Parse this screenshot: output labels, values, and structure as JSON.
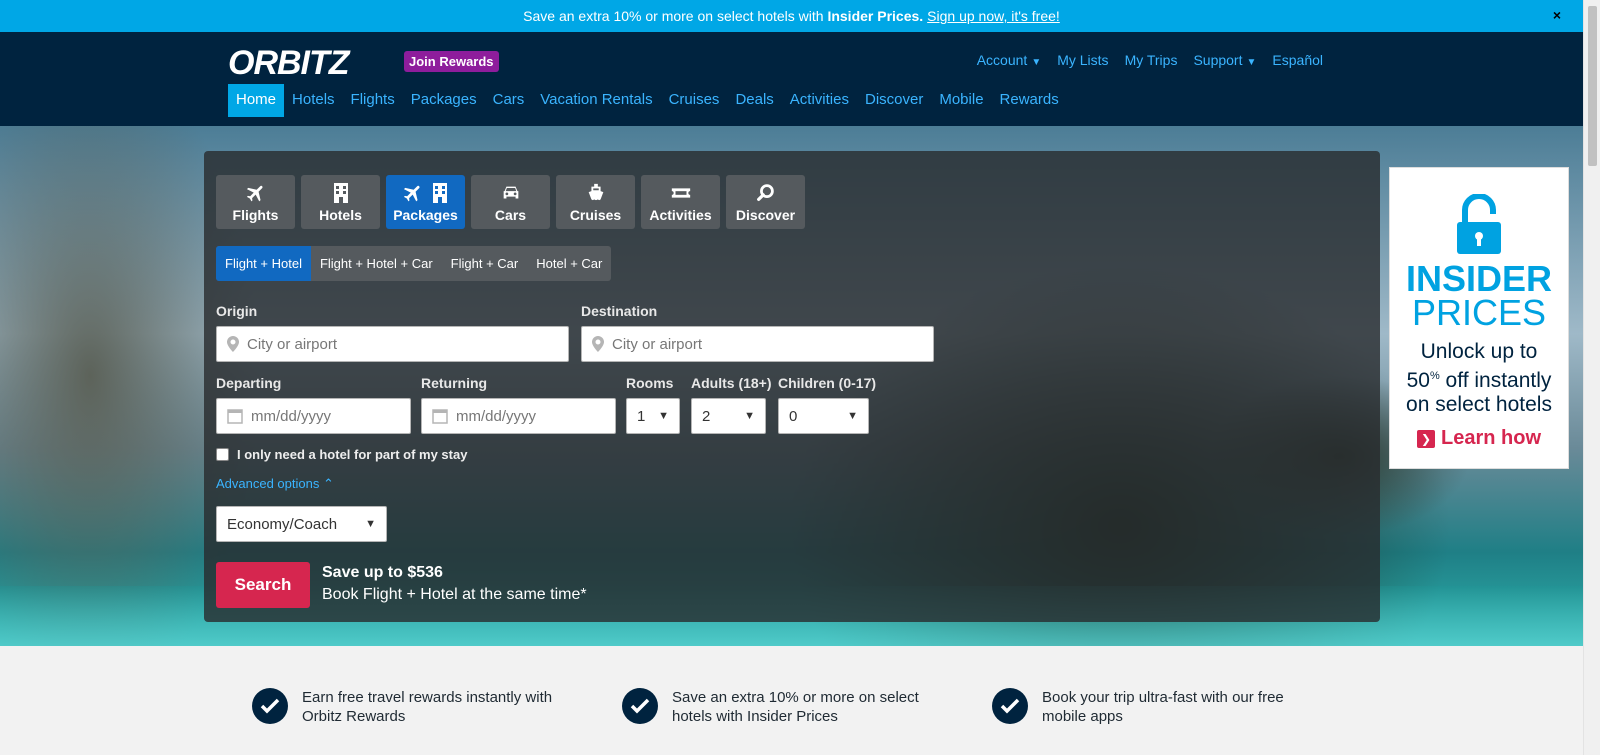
{
  "promo": {
    "text": "Save an extra 10% or more on select hotels with",
    "bold": "Insider Prices.",
    "link": "Sign up now, it's free!",
    "close": "×"
  },
  "header": {
    "logo_text": "ORBITZ",
    "join_rewards": "Join Rewards",
    "util_nav": [
      "Account",
      "My Lists",
      "My Trips",
      "Support",
      "Español"
    ],
    "main_nav": [
      "Home",
      "Hotels",
      "Flights",
      "Packages",
      "Cars",
      "Vacation Rentals",
      "Cruises",
      "Deals",
      "Activities",
      "Discover",
      "Mobile",
      "Rewards"
    ]
  },
  "search": {
    "tabs": [
      {
        "label": "Flights",
        "icon": "plane-icon"
      },
      {
        "label": "Hotels",
        "icon": "building-icon"
      },
      {
        "label": "Packages",
        "icon": "plane-building-icon"
      },
      {
        "label": "Cars",
        "icon": "car-icon"
      },
      {
        "label": "Cruises",
        "icon": "ship-icon"
      },
      {
        "label": "Activities",
        "icon": "ticket-icon"
      },
      {
        "label": "Discover",
        "icon": "magnifier-icon"
      }
    ],
    "subtabs": [
      "Flight + Hotel",
      "Flight + Hotel + Car",
      "Flight + Car",
      "Hotel + Car"
    ],
    "origin_label": "Origin",
    "origin_placeholder": "City or airport",
    "destination_label": "Destination",
    "destination_placeholder": "City or airport",
    "departing_label": "Departing",
    "departing_placeholder": "mm/dd/yyyy",
    "returning_label": "Returning",
    "returning_placeholder": "mm/dd/yyyy",
    "rooms_label": "Rooms",
    "rooms_value": "1",
    "adults_label": "Adults (18+)",
    "adults_value": "2",
    "children_label": "Children (0-17)",
    "children_value": "0",
    "partial_stay": "I only need a hotel for part of my stay",
    "advanced": "Advanced options",
    "cabin_class": "Economy/Coach",
    "search_button": "Search",
    "save_title": "Save up to $536",
    "save_sub": "Book Flight + Hotel at the same time*"
  },
  "ad": {
    "title1": "INSIDER",
    "title2": "PRICES",
    "line1": "Unlock up to",
    "line2_pre": "50",
    "line2_pct": "%",
    "line2_post": " off instantly",
    "line3": "on select hotels",
    "learn": "Learn how"
  },
  "benefits": [
    "Earn free travel rewards instantly with Orbitz Rewards",
    "Save an extra 10% or more on select hotels with Insider Prices",
    "Book your trip ultra-fast with our free mobile apps"
  ],
  "colors": {
    "promo": "#00a7e6",
    "header": "#00233f",
    "accent": "#1169c1",
    "search_button": "#d6264f",
    "rewards_badge": "#8e1d9c"
  }
}
